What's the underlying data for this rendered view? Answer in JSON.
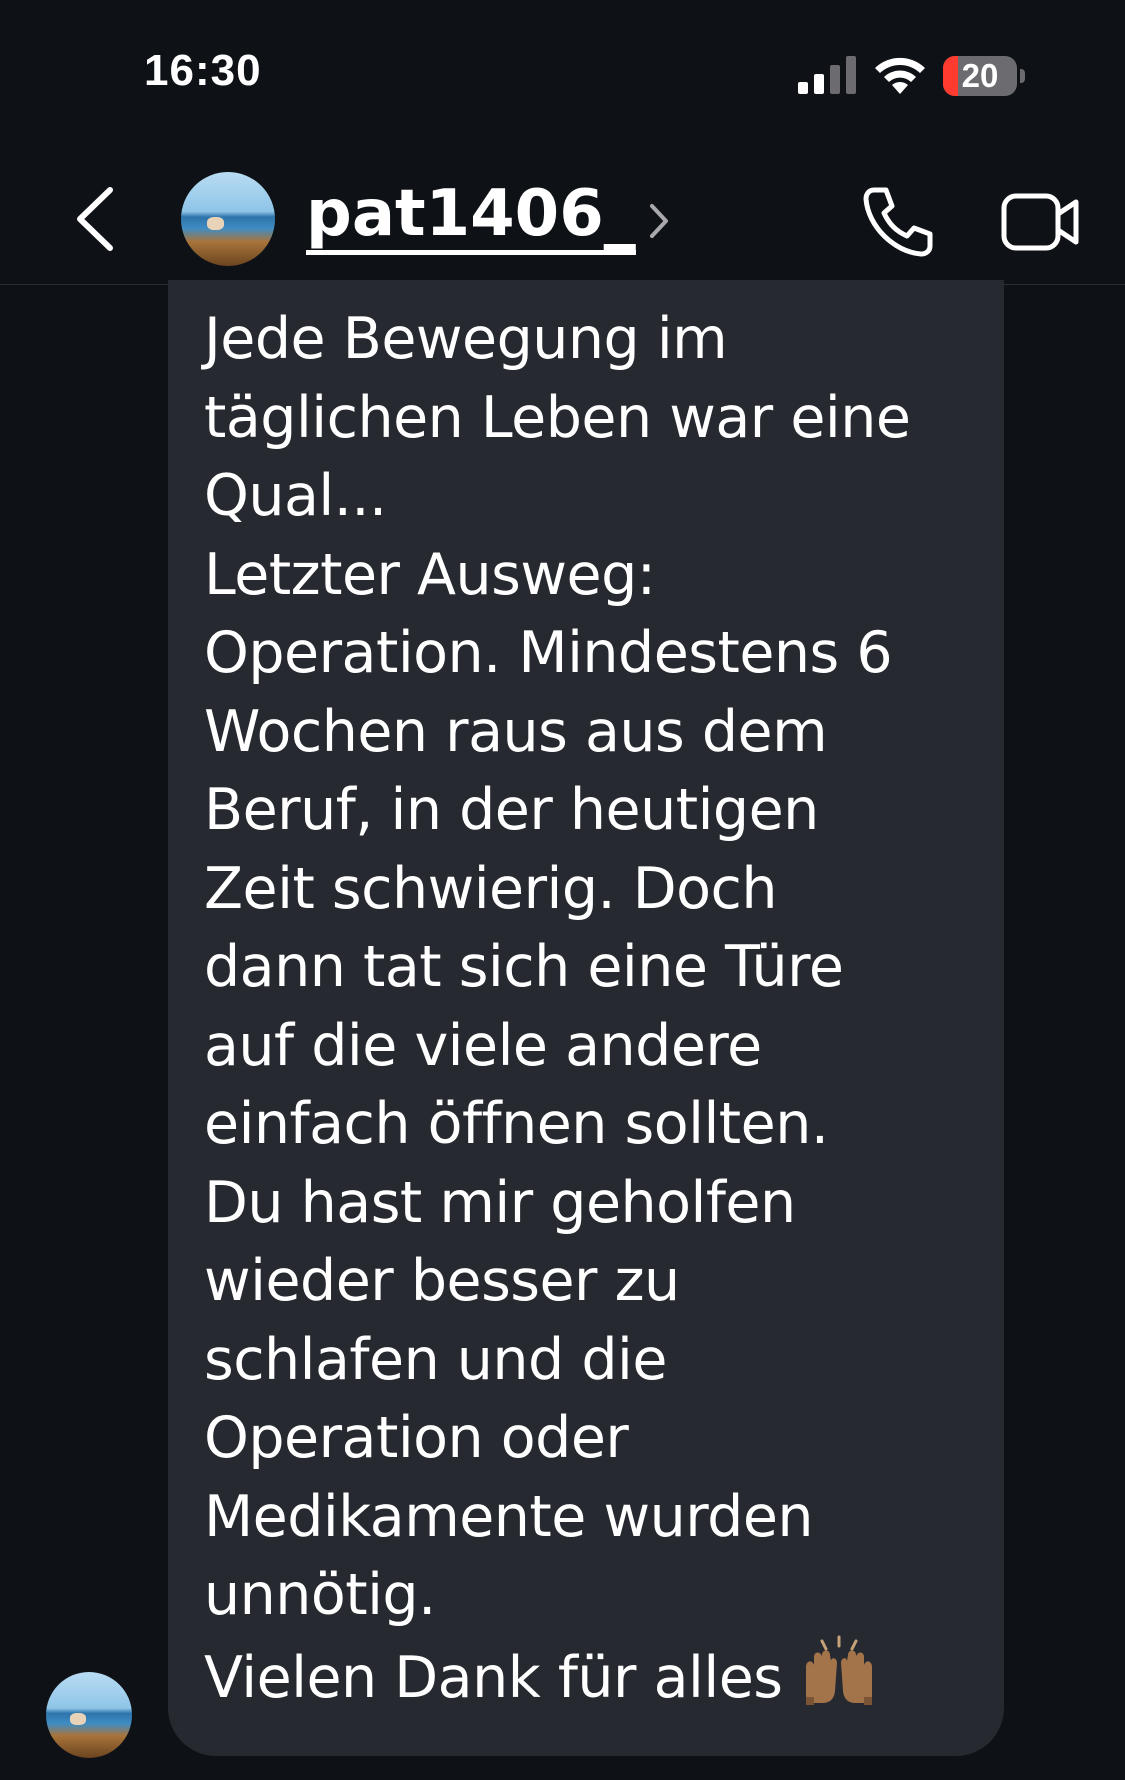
{
  "status_bar": {
    "time": "16:30",
    "battery_level": "20",
    "battery_fraction": 0.2,
    "battery_color": "#ff3b30",
    "signal_icon": "cellular-signal-icon",
    "wifi_icon": "wifi-icon"
  },
  "header": {
    "username": "pat1406_",
    "back_icon": "chevron-left-icon",
    "call_icon": "phone-icon",
    "video_icon": "video-camera-icon",
    "chevron_icon": "chevron-right-icon"
  },
  "message": {
    "text": "Jede Bewegung im\ntäglichen Leben war eine\nQual...\nLetzter Ausweg:\nOperation.  Mindestens 6\nWochen raus aus dem\nBeruf, in der heutigen\nZeit schwierig. Doch\ndann tat sich eine Türe\nauf die viele andere\neinfach öffnen sollten.\nDu hast mir geholfen\nwieder besser zu\nschlafen und die\nOperation oder\nMedikamente wurden\nunnötig.\nVielen Dank für alles ",
    "emoji": "raising-hands-emoji-icon"
  },
  "colors": {
    "background": "#0e1217",
    "bubble": "#26292f",
    "text": "#ffffff"
  }
}
